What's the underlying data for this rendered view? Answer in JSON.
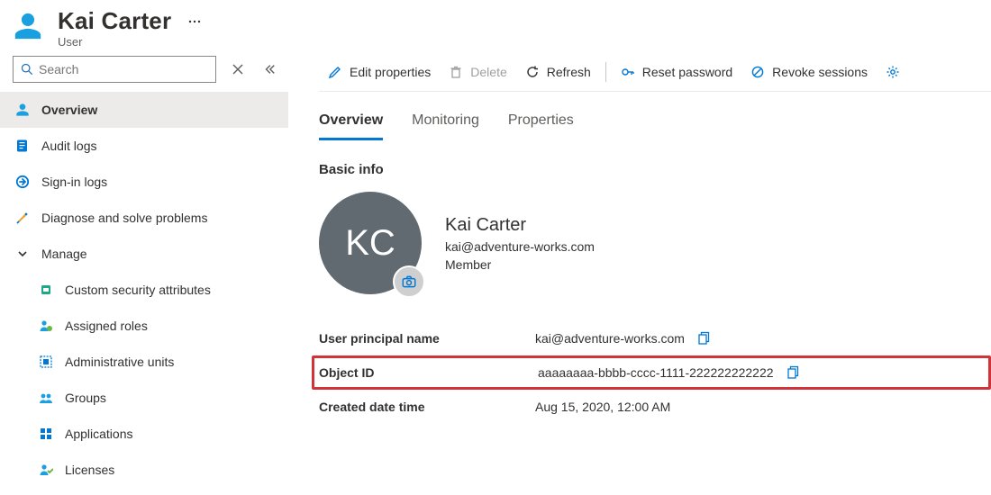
{
  "header": {
    "title": "Kai Carter",
    "subtitle": "User"
  },
  "sidebar": {
    "search_placeholder": "Search",
    "items": [
      {
        "label": "Overview",
        "icon": "user"
      },
      {
        "label": "Audit logs",
        "icon": "log"
      },
      {
        "label": "Sign-in logs",
        "icon": "signin"
      },
      {
        "label": "Diagnose and solve problems",
        "icon": "diagnose"
      }
    ],
    "manage": {
      "label": "Manage",
      "expanded": true,
      "items": [
        {
          "label": "Custom security attributes",
          "icon": "security"
        },
        {
          "label": "Assigned roles",
          "icon": "roles"
        },
        {
          "label": "Administrative units",
          "icon": "adminunits"
        },
        {
          "label": "Groups",
          "icon": "groups"
        },
        {
          "label": "Applications",
          "icon": "apps"
        },
        {
          "label": "Licenses",
          "icon": "licenses"
        }
      ]
    }
  },
  "toolbar": {
    "edit": "Edit properties",
    "delete": "Delete",
    "refresh": "Refresh",
    "reset": "Reset password",
    "revoke": "Revoke sessions"
  },
  "tabs": [
    "Overview",
    "Monitoring",
    "Properties"
  ],
  "active_tab": "Overview",
  "basic_info": {
    "section": "Basic info",
    "initials": "KC",
    "name": "Kai Carter",
    "email": "kai@adventure-works.com",
    "member_type": "Member"
  },
  "properties": {
    "upn": {
      "label": "User principal name",
      "value": "kai@adventure-works.com"
    },
    "object": {
      "label": "Object ID",
      "value": "aaaaaaaa-bbbb-cccc-1111-222222222222"
    },
    "created": {
      "label": "Created date time",
      "value": "Aug 15, 2020, 12:00 AM"
    }
  }
}
